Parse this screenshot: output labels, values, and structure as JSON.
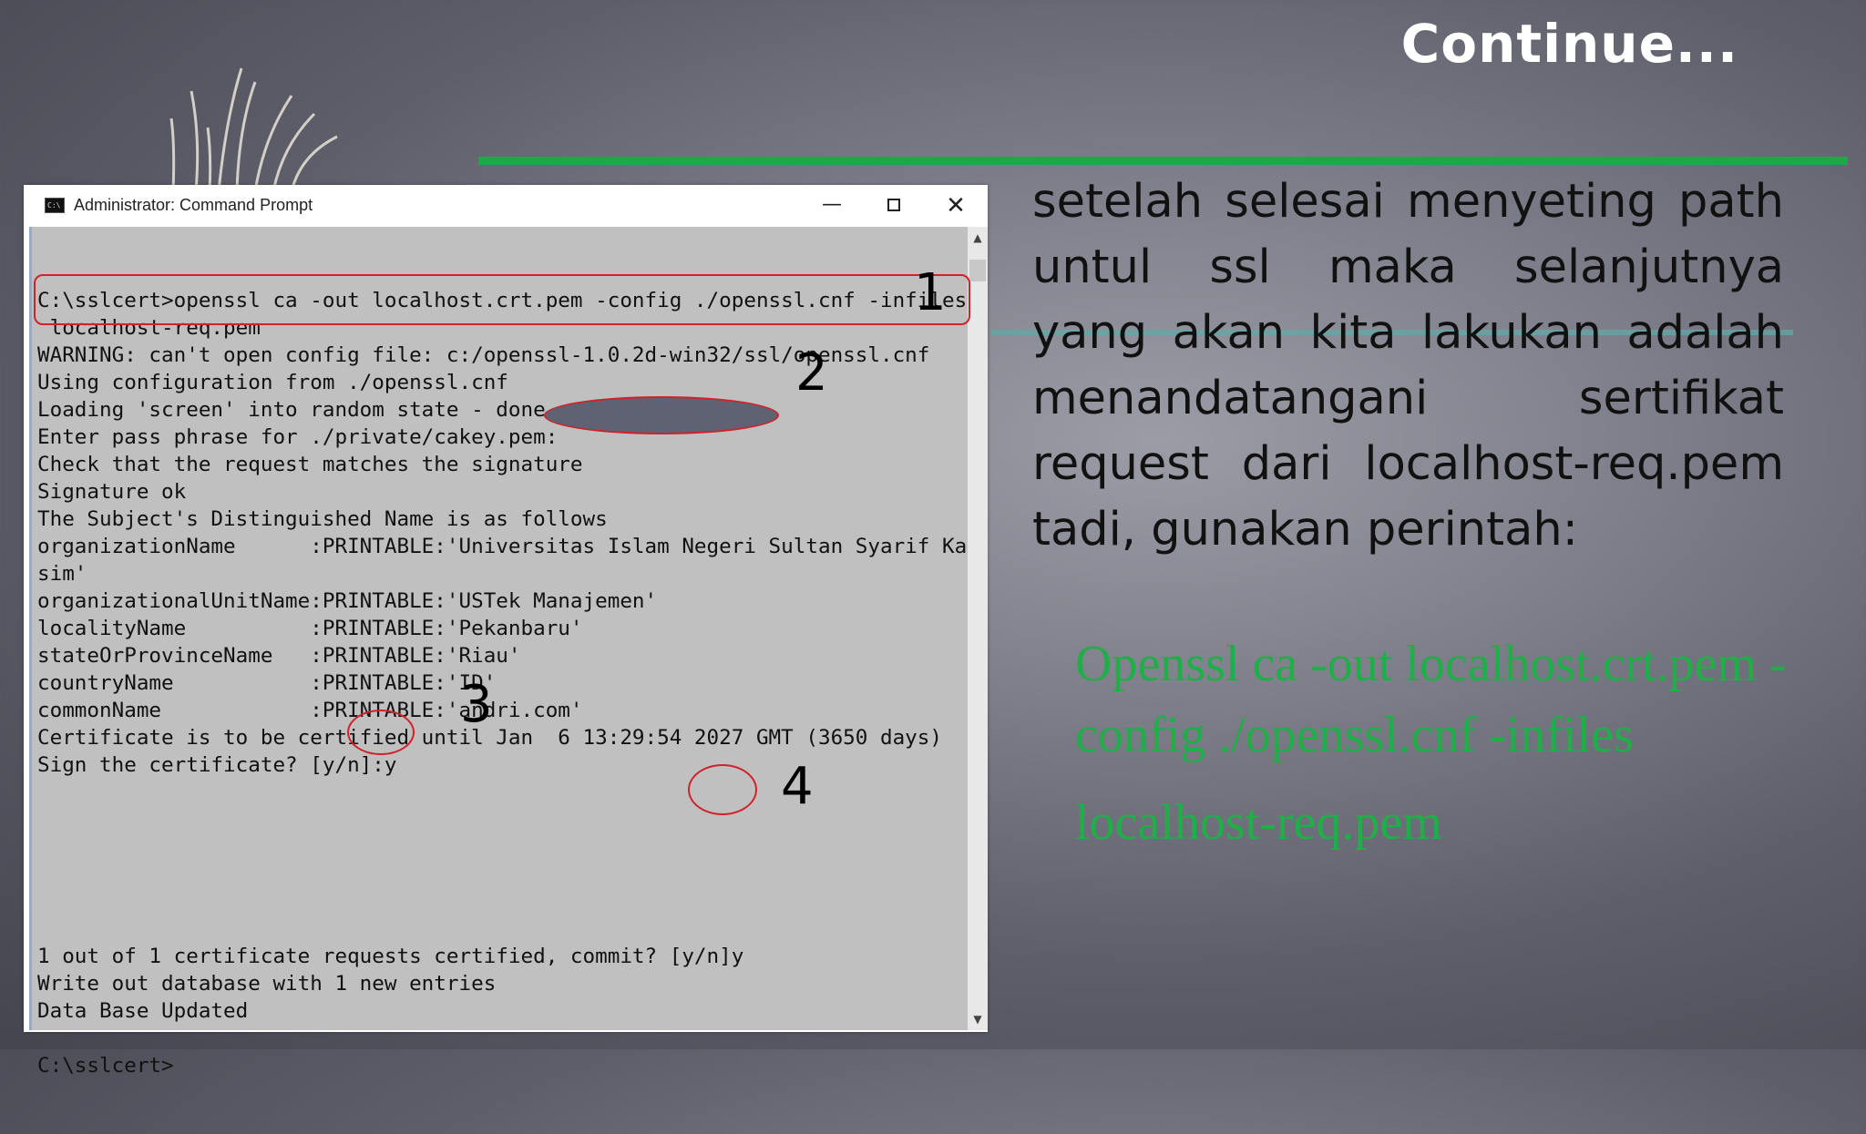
{
  "slide": {
    "title": "Continue...",
    "description": "setelah selesai menyeting path untul ssl maka selanjutnya yang akan kita lakukan adalah menandatangani sertifikat request dari localhost-req.pem tadi, gunakan perintah:",
    "command_line1": "Openssl ca -out localhost.crt.pem -config ./openssl.cnf -infiles",
    "command_line2": "localhost-req.pem",
    "accent_color": "#1fae48"
  },
  "window": {
    "title": "Administrator: Command Prompt",
    "icon": "cmd-icon",
    "minimize_glyph": "—",
    "close_glyph": "✕"
  },
  "console": {
    "lines_top": [
      "C:\\sslcert>openssl ca -out localhost.crt.pem -config ./openssl.cnf -infiles",
      " localhost-req.pem",
      "WARNING: can't open config file: c:/openssl-1.0.2d-win32/ssl/openssl.cnf",
      "Using configuration from ./openssl.cnf",
      "Loading 'screen' into random state - done",
      "Enter pass phrase for ./private/cakey.pem:",
      "Check that the request matches the signature",
      "Signature ok",
      "The Subject's Distinguished Name is as follows",
      "organizationName      :PRINTABLE:'Universitas Islam Negeri Sultan Syarif Ka",
      "sim'",
      "organizationalUnitName:PRINTABLE:'USTek Manajemen'",
      "localityName          :PRINTABLE:'Pekanbaru'",
      "stateOrProvinceName   :PRINTABLE:'Riau'",
      "countryName           :PRINTABLE:'ID'",
      "commonName            :PRINTABLE:'andri.com'",
      "Certificate is to be certified until Jan  6 13:29:54 2027 GMT (3650 days)",
      "Sign the certificate? [y/n]:y"
    ],
    "lines_bottom": [
      "1 out of 1 certificate requests certified, commit? [y/n]y",
      "Write out database with 1 new entries",
      "Data Base Updated",
      "",
      "C:\\sslcert>"
    ]
  },
  "annotations": {
    "n1": "1",
    "n2": "2",
    "n3": "3",
    "n4": "4",
    "color": "#d0222a"
  }
}
